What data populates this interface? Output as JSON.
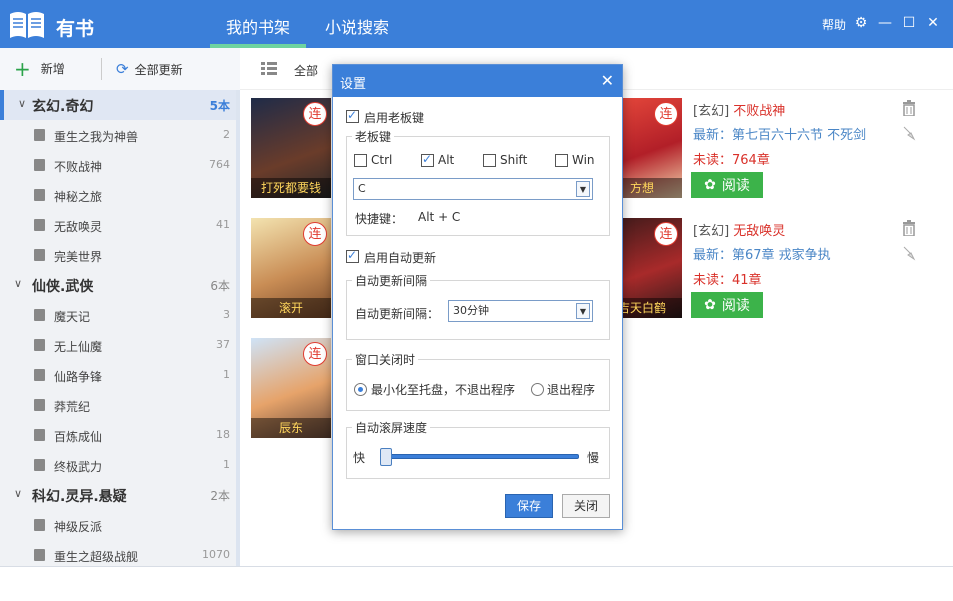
{
  "app": {
    "name": "有书"
  },
  "tabs": [
    {
      "label": "我的书架"
    },
    {
      "label": "小说搜索"
    }
  ],
  "header": {
    "help": "帮助"
  },
  "toolbar": {
    "add": "新增",
    "update_all": "全部更新"
  },
  "content": {
    "filter_all": "全部"
  },
  "sidebar": {
    "groups": [
      {
        "name": "玄幻.奇幻",
        "count": "5本",
        "items": [
          {
            "name": "重生之我为神兽",
            "count": "2"
          },
          {
            "name": "不败战神",
            "count": "764"
          },
          {
            "name": "神秘之旅",
            "count": ""
          },
          {
            "name": "无敌唤灵",
            "count": "41"
          },
          {
            "name": "完美世界",
            "count": ""
          }
        ]
      },
      {
        "name": "仙侠.武侠",
        "count": "6本",
        "items": [
          {
            "name": "魔天记",
            "count": "3"
          },
          {
            "name": "无上仙魔",
            "count": "37"
          },
          {
            "name": "仙路争锋",
            "count": "1"
          },
          {
            "name": "莽荒纪",
            "count": ""
          },
          {
            "name": "百炼成仙",
            "count": "18"
          },
          {
            "name": "终极武力",
            "count": "1"
          }
        ]
      },
      {
        "name": "科幻.灵异.悬疑",
        "count": "2本",
        "items": [
          {
            "name": "神级反派",
            "count": ""
          },
          {
            "name": "重生之超级战舰",
            "count": "1070"
          }
        ]
      }
    ]
  },
  "books": [
    {
      "cover_title": "打死都要钱",
      "badge": "连"
    },
    {
      "cover_title": "滚开",
      "badge": "连"
    },
    {
      "cover_title": "辰东",
      "badge": "连"
    },
    {
      "cover_title": "方想",
      "badge": "连",
      "tag": "[玄幻]",
      "title": "不败战神",
      "latest": "最新：第七百六十六节 不死剑",
      "unread": "未读：764章",
      "read": "阅读"
    },
    {
      "cover_title": "吉天白鹤",
      "badge": "连",
      "tag": "[玄幻]",
      "title": "无敌唤灵",
      "latest": "最新：第67章 戎家争执",
      "unread": "未读：41章",
      "read": "阅读"
    }
  ],
  "dialog": {
    "title": "设置",
    "boss_key_enable": "启用老板键",
    "boss_key_group": "老板键",
    "modifiers": [
      "Ctrl",
      "Alt",
      "Shift",
      "Win"
    ],
    "key_value": "C",
    "hotkey_label": "快捷键：",
    "hotkey_value": "Alt + C",
    "auto_update_enable": "启用自动更新",
    "interval_group": "自动更新间隔",
    "interval_label": "自动更新间隔：",
    "interval_value": "30分钟",
    "close_group": "窗口关闭时",
    "close_opt_minimize": "最小化至托盘，不退出程序",
    "close_opt_exit": "退出程序",
    "scroll_group": "自动滚屏速度",
    "speed_fast": "快",
    "speed_slow": "慢",
    "speed_level": 0.02,
    "save": "保存",
    "close": "关闭"
  }
}
